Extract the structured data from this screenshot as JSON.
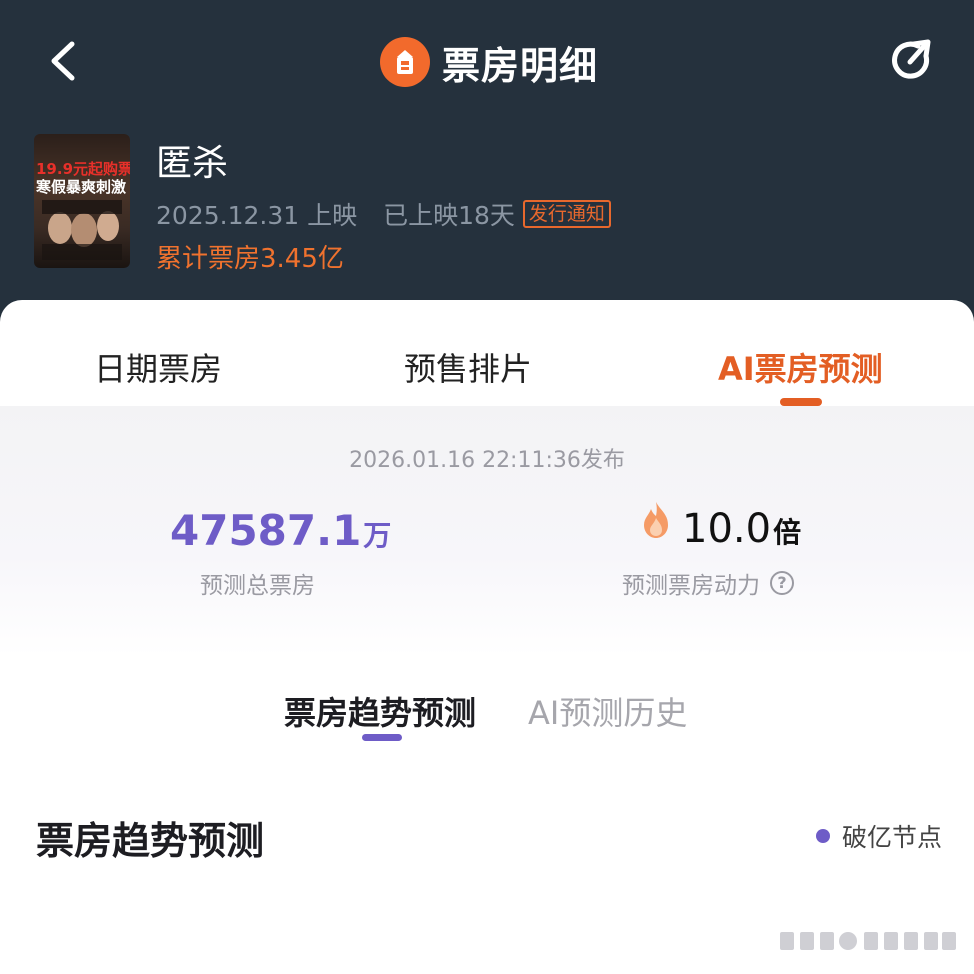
{
  "header": {
    "title": "票房明细",
    "back_icon": "chevron-left-icon",
    "share_icon": "share-icon"
  },
  "movie": {
    "name": "匿杀",
    "release_date": "2025.12.31 上映",
    "days_showing": "已上映18天",
    "badge": "发行通知",
    "cumulative_box_office": "累计票房3.45亿",
    "poster": {
      "line1": "19.9元起购票",
      "line2": "寒假暴爽刺激"
    }
  },
  "tabs": [
    {
      "label": "日期票房",
      "active": false
    },
    {
      "label": "预售排片",
      "active": false
    },
    {
      "label": "AI票房预测",
      "active": true
    }
  ],
  "prediction": {
    "published": "2026.01.16 22:11:36发布",
    "total_value": "47587.1",
    "total_unit": "万",
    "total_label": "预测总票房",
    "multiplier_value": "10.0",
    "multiplier_unit": "倍",
    "multiplier_label": "预测票房动力"
  },
  "subtabs": [
    {
      "label": "票房趋势预测",
      "active": true
    },
    {
      "label": "AI预测历史",
      "active": false
    }
  ],
  "section": {
    "title": "票房趋势预测",
    "legend": "破亿节点"
  },
  "colors": {
    "header_bg": "#25313d",
    "accent_orange": "#e35e24",
    "accent_purple": "#6e5cc7"
  }
}
